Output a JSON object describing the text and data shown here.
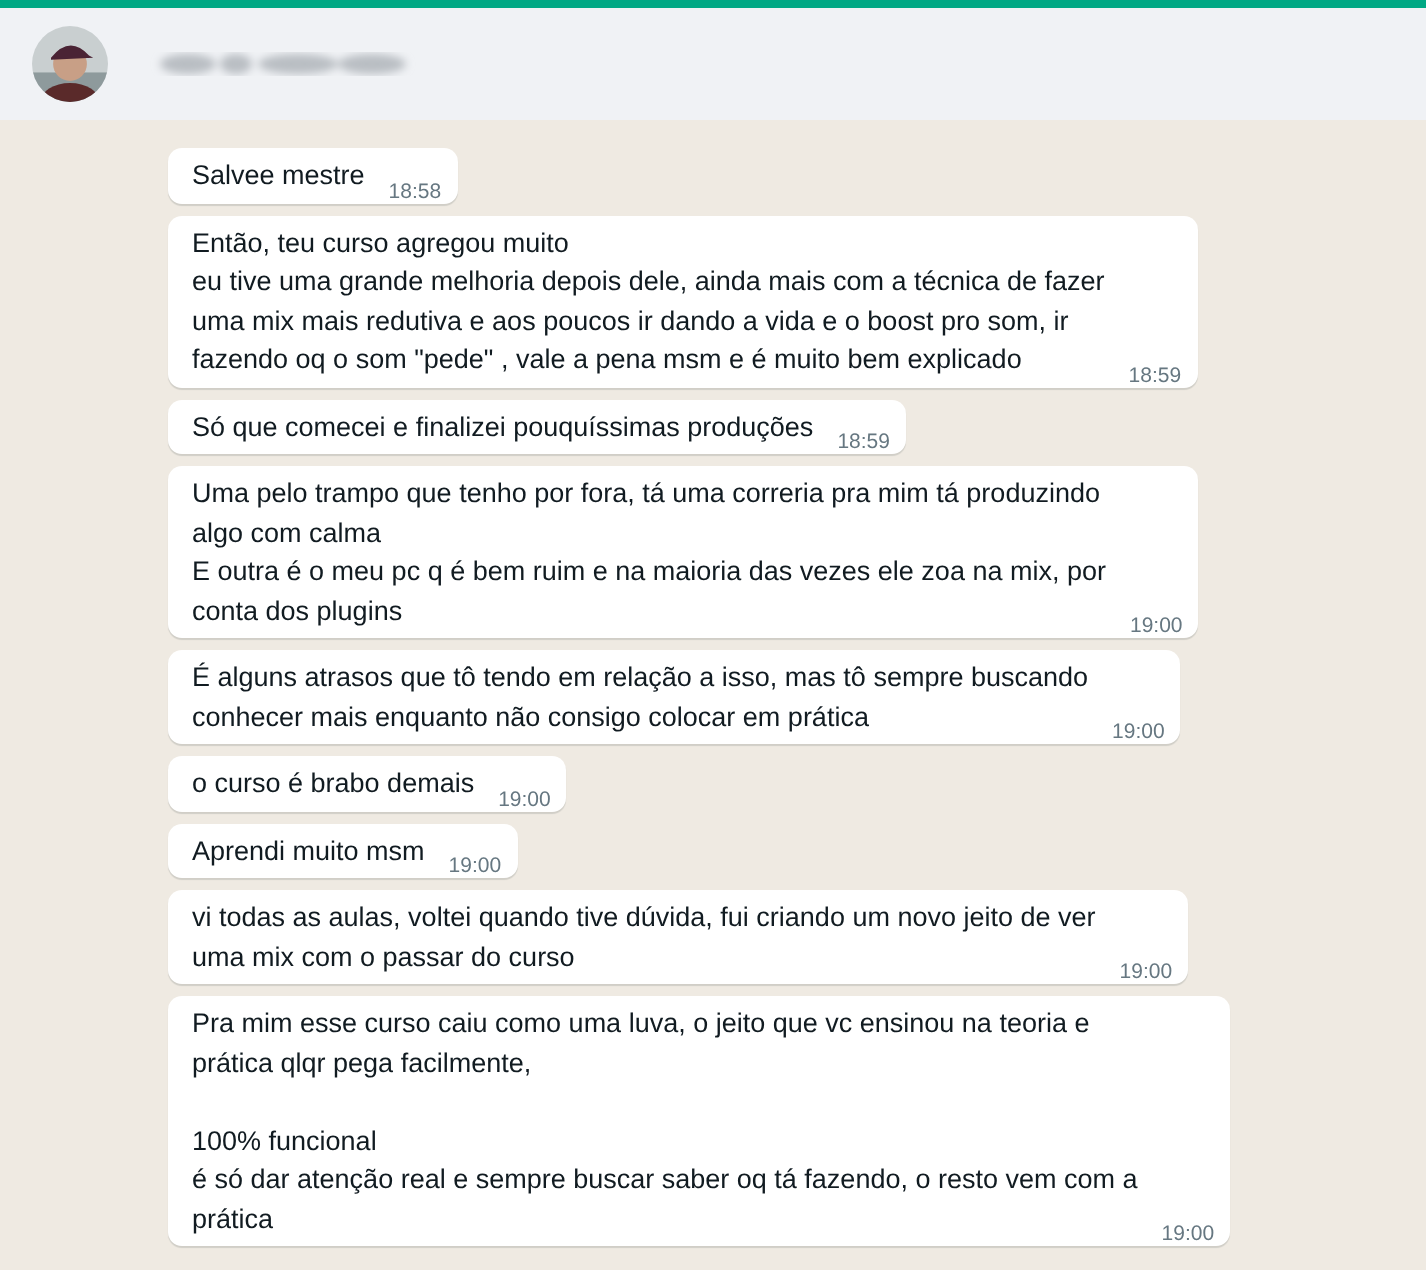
{
  "messages": [
    {
      "text": "Salvee mestre",
      "time": "18:58"
    },
    {
      "text": "Então, teu curso agregou muito\neu tive uma grande melhoria depois dele, ainda mais com a técnica de fazer\numa mix mais redutiva e aos poucos ir dando a vida e o boost pro som, ir\nfazendo oq o som \"pede\" , vale a pena msm e é muito bem explicado",
      "time": "18:59"
    },
    {
      "text": "Só que comecei e finalizei pouquíssimas produções",
      "time": "18:59"
    },
    {
      "text": "Uma pelo trampo que tenho por fora, tá uma correria pra mim tá produzindo\nalgo com calma\nE outra é o meu pc q é bem ruim e na maioria das vezes ele zoa na mix, por\nconta dos plugins",
      "time": "19:00"
    },
    {
      "text": "É alguns atrasos que tô tendo em relação a isso, mas tô sempre buscando\nconhecer mais enquanto não consigo colocar em prática",
      "time": "19:00"
    },
    {
      "text": "o curso é brabo demais",
      "time": "19:00"
    },
    {
      "text": "Aprendi muito msm",
      "time": "19:00"
    },
    {
      "text": "vi todas as aulas, voltei quando tive dúvida, fui criando um novo jeito de ver\numa mix com o passar do curso",
      "time": "19:00"
    },
    {
      "text": "Pra mim esse curso caiu como uma luva, o jeito que vc ensinou na teoria e\nprática qlqr pega facilmente,\n\n100% funcional\né só dar atenção real e sempre buscar saber oq tá fazendo, o resto vem com a\nprática",
      "time": "19:00"
    }
  ]
}
